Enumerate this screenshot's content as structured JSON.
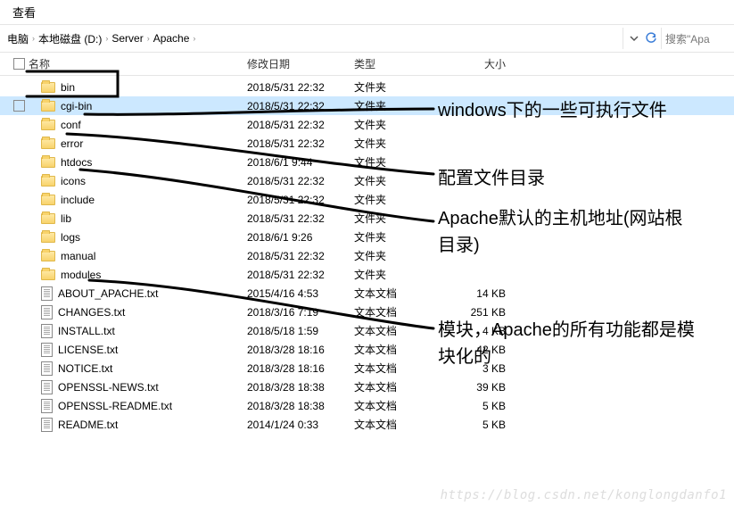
{
  "menu": {
    "view": "查看"
  },
  "breadcrumb": {
    "root": "电脑",
    "items": [
      "本地磁盘 (D:)",
      "Server",
      "Apache"
    ]
  },
  "search": {
    "placeholder": "搜索\"Apa"
  },
  "columns": {
    "name": "名称",
    "date": "修改日期",
    "type": "类型",
    "size": "大小"
  },
  "rows": [
    {
      "icon": "folder",
      "name": "bin",
      "date": "2018/5/31 22:32",
      "type": "文件夹",
      "size": ""
    },
    {
      "icon": "folder",
      "name": "cgi-bin",
      "date": "2018/5/31 22:32",
      "type": "文件夹",
      "size": "",
      "selected": true
    },
    {
      "icon": "folder",
      "name": "conf",
      "date": "2018/5/31 22:32",
      "type": "文件夹",
      "size": ""
    },
    {
      "icon": "folder",
      "name": "error",
      "date": "2018/5/31 22:32",
      "type": "文件夹",
      "size": ""
    },
    {
      "icon": "folder",
      "name": "htdocs",
      "date": "2018/6/1 9:44",
      "type": "文件夹",
      "size": ""
    },
    {
      "icon": "folder",
      "name": "icons",
      "date": "2018/5/31 22:32",
      "type": "文件夹",
      "size": ""
    },
    {
      "icon": "folder",
      "name": "include",
      "date": "2018/5/31 22:32",
      "type": "文件夹",
      "size": ""
    },
    {
      "icon": "folder",
      "name": "lib",
      "date": "2018/5/31 22:32",
      "type": "文件夹",
      "size": ""
    },
    {
      "icon": "folder",
      "name": "logs",
      "date": "2018/6/1 9:26",
      "type": "文件夹",
      "size": ""
    },
    {
      "icon": "folder",
      "name": "manual",
      "date": "2018/5/31 22:32",
      "type": "文件夹",
      "size": ""
    },
    {
      "icon": "folder",
      "name": "modules",
      "date": "2018/5/31 22:32",
      "type": "文件夹",
      "size": ""
    },
    {
      "icon": "file",
      "name": "ABOUT_APACHE.txt",
      "date": "2015/4/16 4:53",
      "type": "文本文档",
      "size": "14 KB"
    },
    {
      "icon": "file",
      "name": "CHANGES.txt",
      "date": "2018/3/16 7:19",
      "type": "文本文档",
      "size": "251 KB"
    },
    {
      "icon": "file",
      "name": "INSTALL.txt",
      "date": "2018/5/18 1:59",
      "type": "文本文档",
      "size": "4 KB"
    },
    {
      "icon": "file",
      "name": "LICENSE.txt",
      "date": "2018/3/28 18:16",
      "type": "文本文档",
      "size": "42 KB"
    },
    {
      "icon": "file",
      "name": "NOTICE.txt",
      "date": "2018/3/28 18:16",
      "type": "文本文档",
      "size": "3 KB"
    },
    {
      "icon": "file",
      "name": "OPENSSL-NEWS.txt",
      "date": "2018/3/28 18:38",
      "type": "文本文档",
      "size": "39 KB"
    },
    {
      "icon": "file",
      "name": "OPENSSL-README.txt",
      "date": "2018/3/28 18:38",
      "type": "文本文档",
      "size": "5 KB"
    },
    {
      "icon": "file",
      "name": "README.txt",
      "date": "2014/1/24 0:33",
      "type": "文本文档",
      "size": "5 KB"
    }
  ],
  "annotations": {
    "a1": "windows下的一些可执行文件",
    "a2": "配置文件目录",
    "a3": "Apache默认的主机地址(网站根目录)",
    "a4": "模块，Apache的所有功能都是模块化的"
  },
  "watermark": "https://blog.csdn.net/konglongdanfo1"
}
